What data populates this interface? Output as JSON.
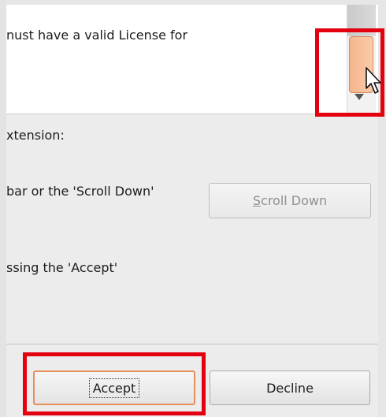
{
  "license": {
    "text_line": "nust have a valid License for"
  },
  "instructions": {
    "line1": "xtension:",
    "line2": "bar or the 'Scroll Down'",
    "line3": "ssing the 'Accept'"
  },
  "buttons": {
    "scroll_down_mnemonic": "S",
    "scroll_down_rest": "croll Down",
    "accept_label": "Accept",
    "decline_label": "Decline"
  },
  "colors": {
    "highlight": "#e3000f",
    "scroll_thumb": "#f8c09c",
    "accept_focus_border": "#e78f5a"
  },
  "icons": {
    "scrollbar_down_arrow": "down-arrow-icon",
    "cursor": "mouse-pointer-icon"
  }
}
